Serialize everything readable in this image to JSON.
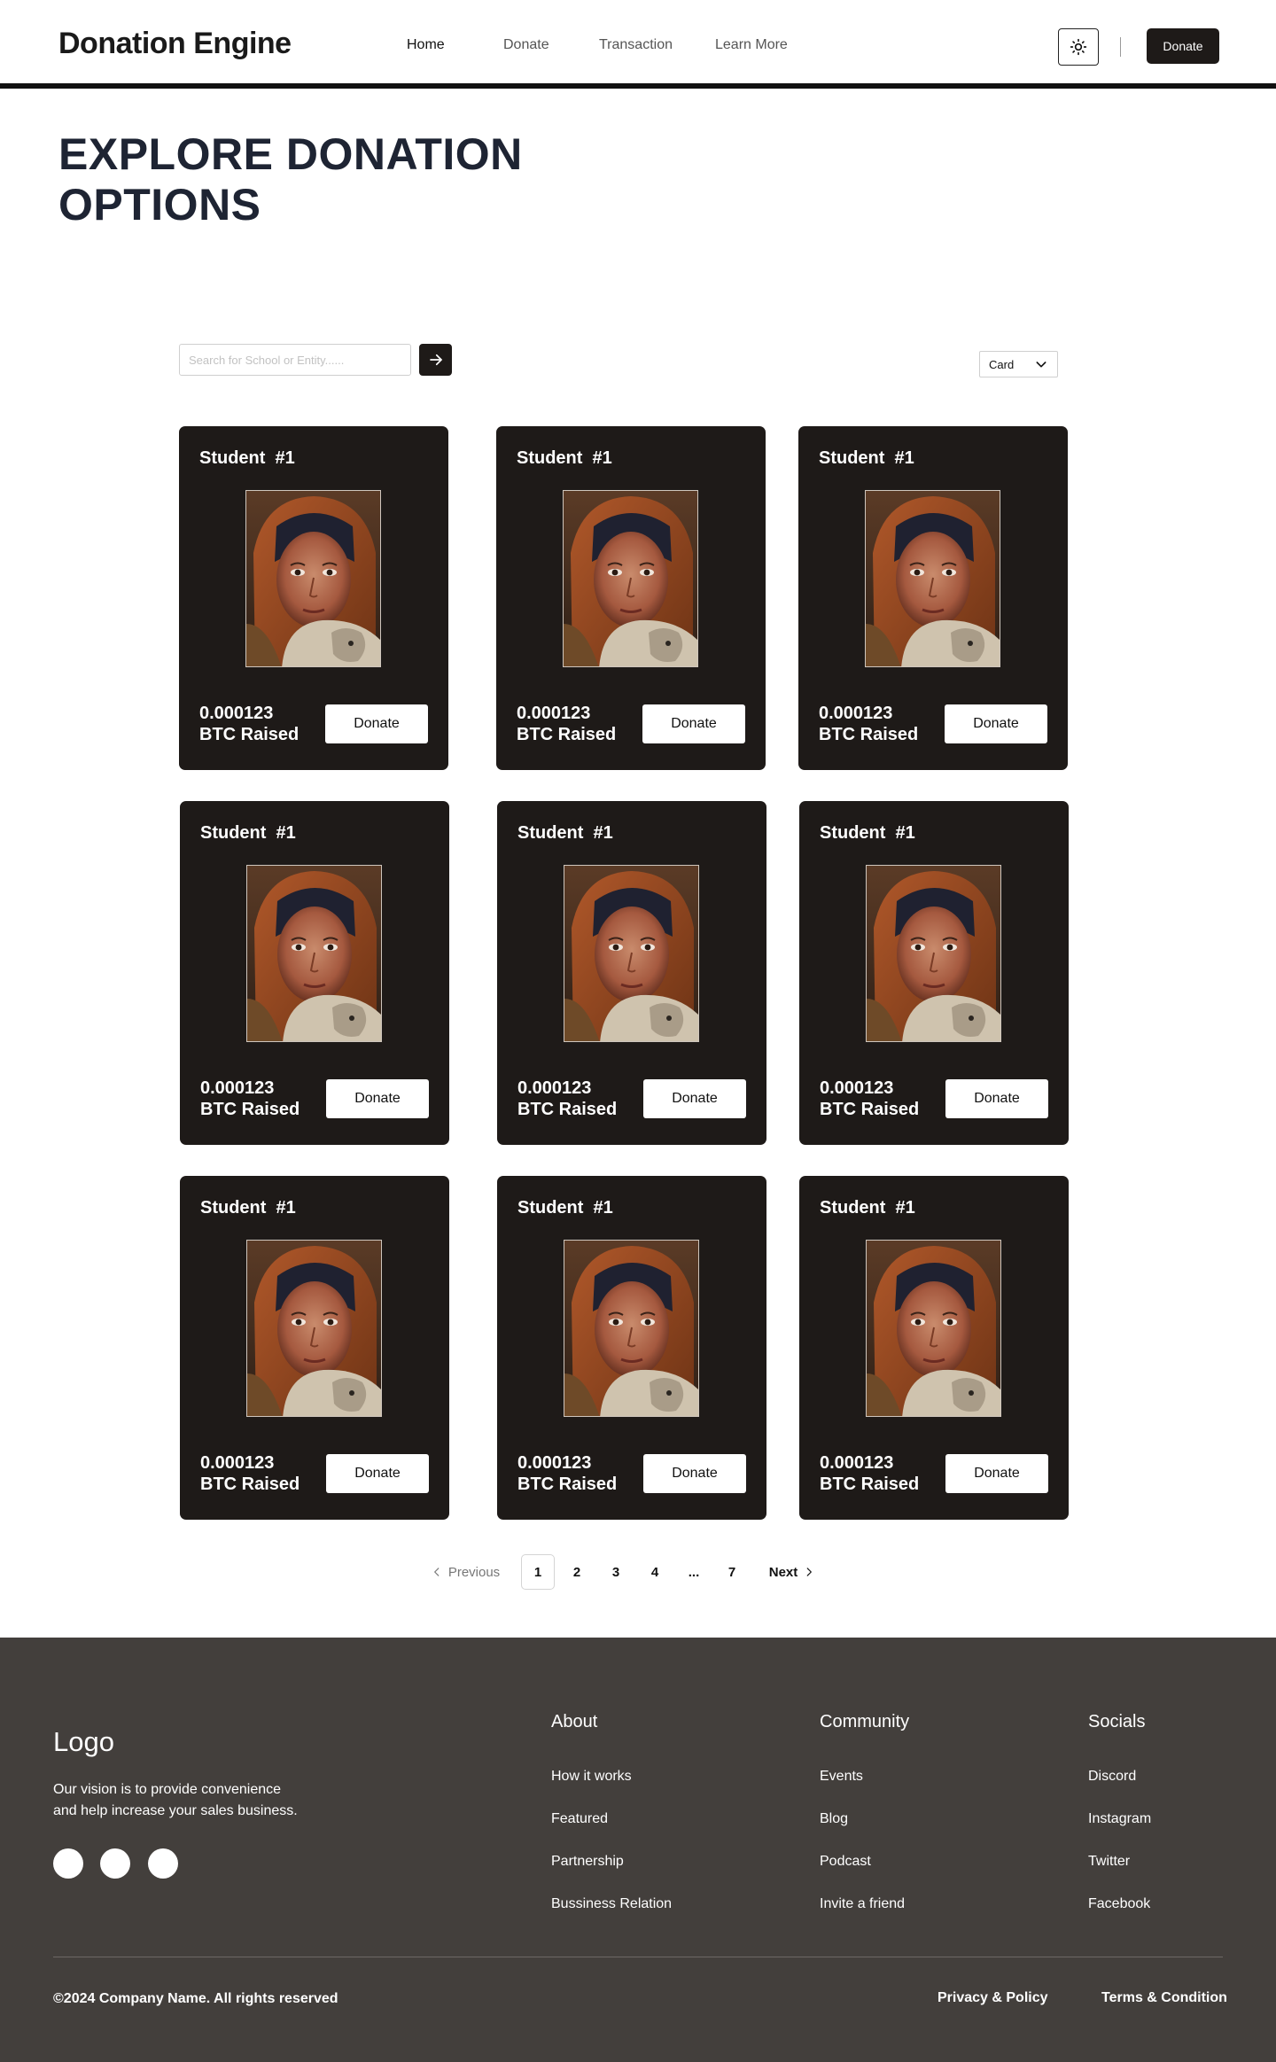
{
  "header": {
    "brand": "Donation Engine",
    "nav": [
      {
        "label": "Home",
        "active": true
      },
      {
        "label": "Donate",
        "active": false
      },
      {
        "label": "Transaction",
        "active": false
      },
      {
        "label": "Learn More",
        "active": false
      }
    ],
    "theme_icon": "sun-icon",
    "donate_label": "Donate"
  },
  "hero": {
    "title_line1": "EXPLORE DONATION",
    "title_line2": "OPTIONS"
  },
  "search": {
    "placeholder": "Search for School or Entity......",
    "submit_icon": "arrow-right-icon",
    "view_selected": "Card"
  },
  "cards": [
    {
      "title": "Student  #1",
      "amount": "0.000123",
      "unit": "BTC Raised",
      "donate_label": "Donate"
    },
    {
      "title": "Student  #1",
      "amount": "0.000123",
      "unit": "BTC Raised",
      "donate_label": "Donate"
    },
    {
      "title": "Student  #1",
      "amount": "0.000123",
      "unit": "BTC Raised",
      "donate_label": "Donate"
    },
    {
      "title": "Student  #1",
      "amount": "0.000123",
      "unit": "BTC Raised",
      "donate_label": "Donate"
    },
    {
      "title": "Student  #1",
      "amount": "0.000123",
      "unit": "BTC Raised",
      "donate_label": "Donate"
    },
    {
      "title": "Student  #1",
      "amount": "0.000123",
      "unit": "BTC Raised",
      "donate_label": "Donate"
    },
    {
      "title": "Student  #1",
      "amount": "0.000123",
      "unit": "BTC Raised",
      "donate_label": "Donate"
    },
    {
      "title": "Student  #1",
      "amount": "0.000123",
      "unit": "BTC Raised",
      "donate_label": "Donate"
    },
    {
      "title": "Student  #1",
      "amount": "0.000123",
      "unit": "BTC Raised",
      "donate_label": "Donate"
    }
  ],
  "pagination": {
    "previous": "Previous",
    "pages": [
      "1",
      "2",
      "3",
      "4",
      "...",
      "7"
    ],
    "current": "1",
    "next": "Next"
  },
  "footer": {
    "logo": "Logo",
    "vision_line1": "Our vision is to provide convenience",
    "vision_line2": "and help increase your sales business.",
    "columns": [
      {
        "heading": "About",
        "links": [
          "How it works",
          "Featured",
          "Partnership",
          "Bussiness Relation"
        ]
      },
      {
        "heading": "Community",
        "links": [
          "Events",
          "Blog",
          "Podcast",
          "Invite a friend"
        ]
      },
      {
        "heading": "Socials",
        "links": [
          "Discord",
          "Instagram",
          "Twitter",
          "Facebook"
        ]
      }
    ],
    "copyright": "©2024 Company Name. All rights reserved",
    "privacy": "Privacy & Policy",
    "terms": "Terms & Condition"
  }
}
